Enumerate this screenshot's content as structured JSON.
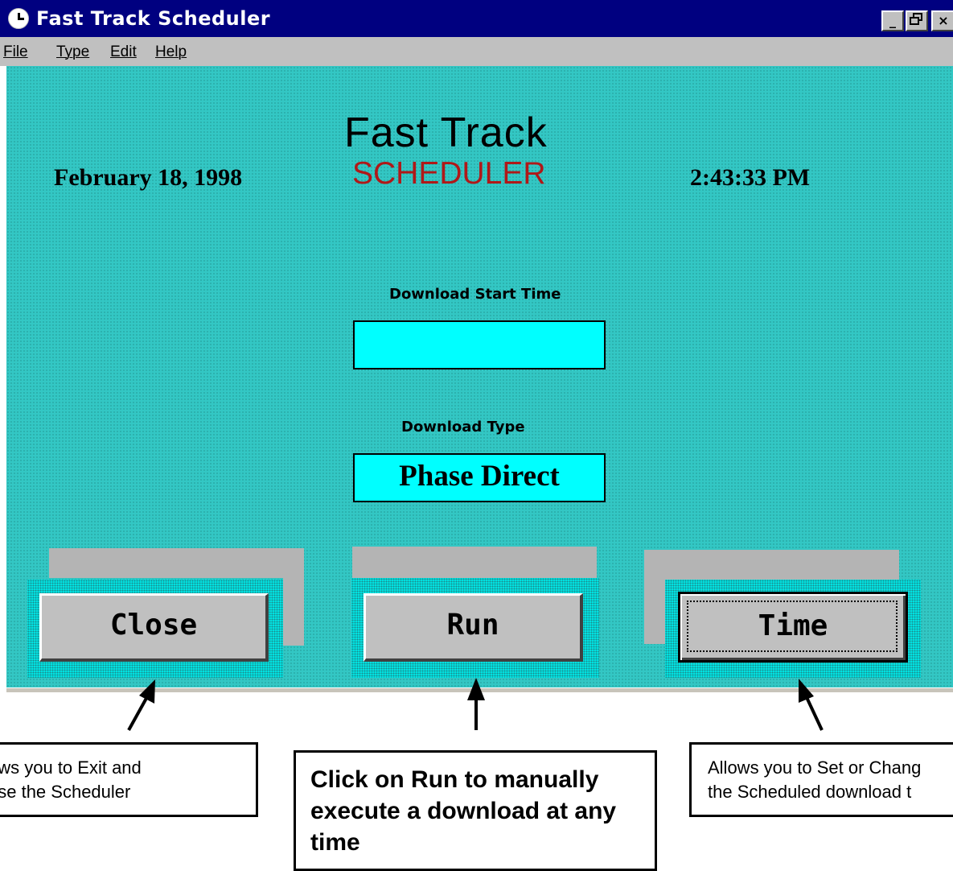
{
  "window": {
    "title": "Fast Track Scheduler",
    "controls": {
      "minimize": "_",
      "maximize": "Б",
      "close": "×"
    }
  },
  "menu": {
    "items": [
      "File",
      "Type",
      "Edit",
      "Help"
    ]
  },
  "main": {
    "brand_line1": "Fast  Track",
    "brand_line2": "SCHEDULER",
    "date": "February 18, 1998",
    "time": "2:43:33 PM",
    "download_start_time_label": "Download Start Time",
    "download_start_time_value": "",
    "download_type_label": "Download Type",
    "download_type_value": "Phase Direct"
  },
  "buttons": {
    "close": "Close",
    "run": "Run",
    "time": "Time"
  },
  "annotations": {
    "close_line1": "ows you to Exit  and",
    "close_line2": "ose the Scheduler",
    "run": "Click on Run to manually execute  a download at any time",
    "time_line1": "Allows you to Set or Chang",
    "time_line2": "the Scheduled download t"
  },
  "colors": {
    "titlebar": "#000080",
    "client": "#33c7c4",
    "field": "#00ffff",
    "scheduler_text": "#b01818"
  }
}
